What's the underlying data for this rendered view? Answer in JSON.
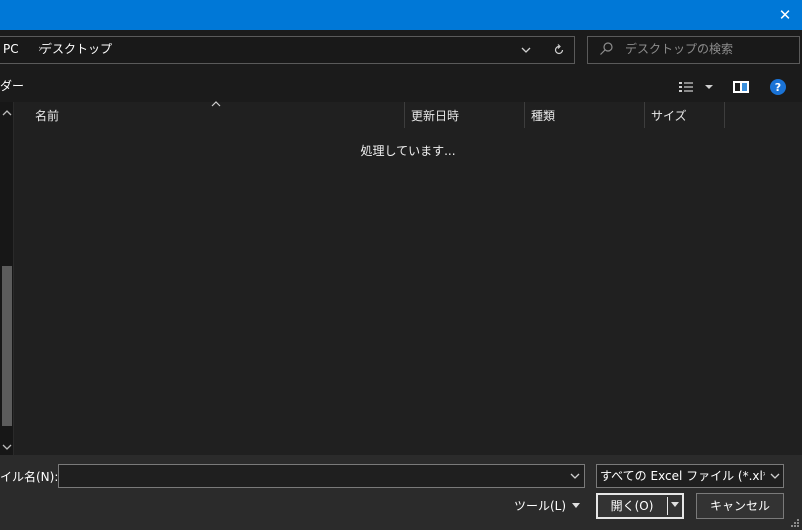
{
  "colors": {
    "accent": "#0078d7",
    "background": "#202020",
    "help": "#1a73d6"
  },
  "titlebar": {
    "close_glyph": "✕"
  },
  "address": {
    "pc": "PC",
    "separator": "›",
    "folder": "デスクトップ"
  },
  "search": {
    "placeholder": "デスクトップの検索"
  },
  "toolbar": {
    "new_folder": "ダー",
    "help_glyph": "?"
  },
  "columns": {
    "name": "名前",
    "date": "更新日時",
    "type": "種類",
    "size": "サイズ"
  },
  "content": {
    "status": "処理しています..."
  },
  "bottom": {
    "filename_label": "イル名(N):",
    "filename_value": "",
    "filter": "すべての Excel ファイル (*.xl*;*.xlsx",
    "tools": "ツール(L)",
    "open": "開く(O)",
    "cancel": "キャンセル"
  },
  "icons": [
    "close-icon",
    "chevron-down-icon",
    "refresh-icon",
    "search-icon",
    "view-options-icon",
    "preview-pane-icon",
    "help-icon",
    "sort-arrow-icon",
    "scroll-up-icon",
    "scroll-down-icon",
    "resize-grip-icon"
  ]
}
